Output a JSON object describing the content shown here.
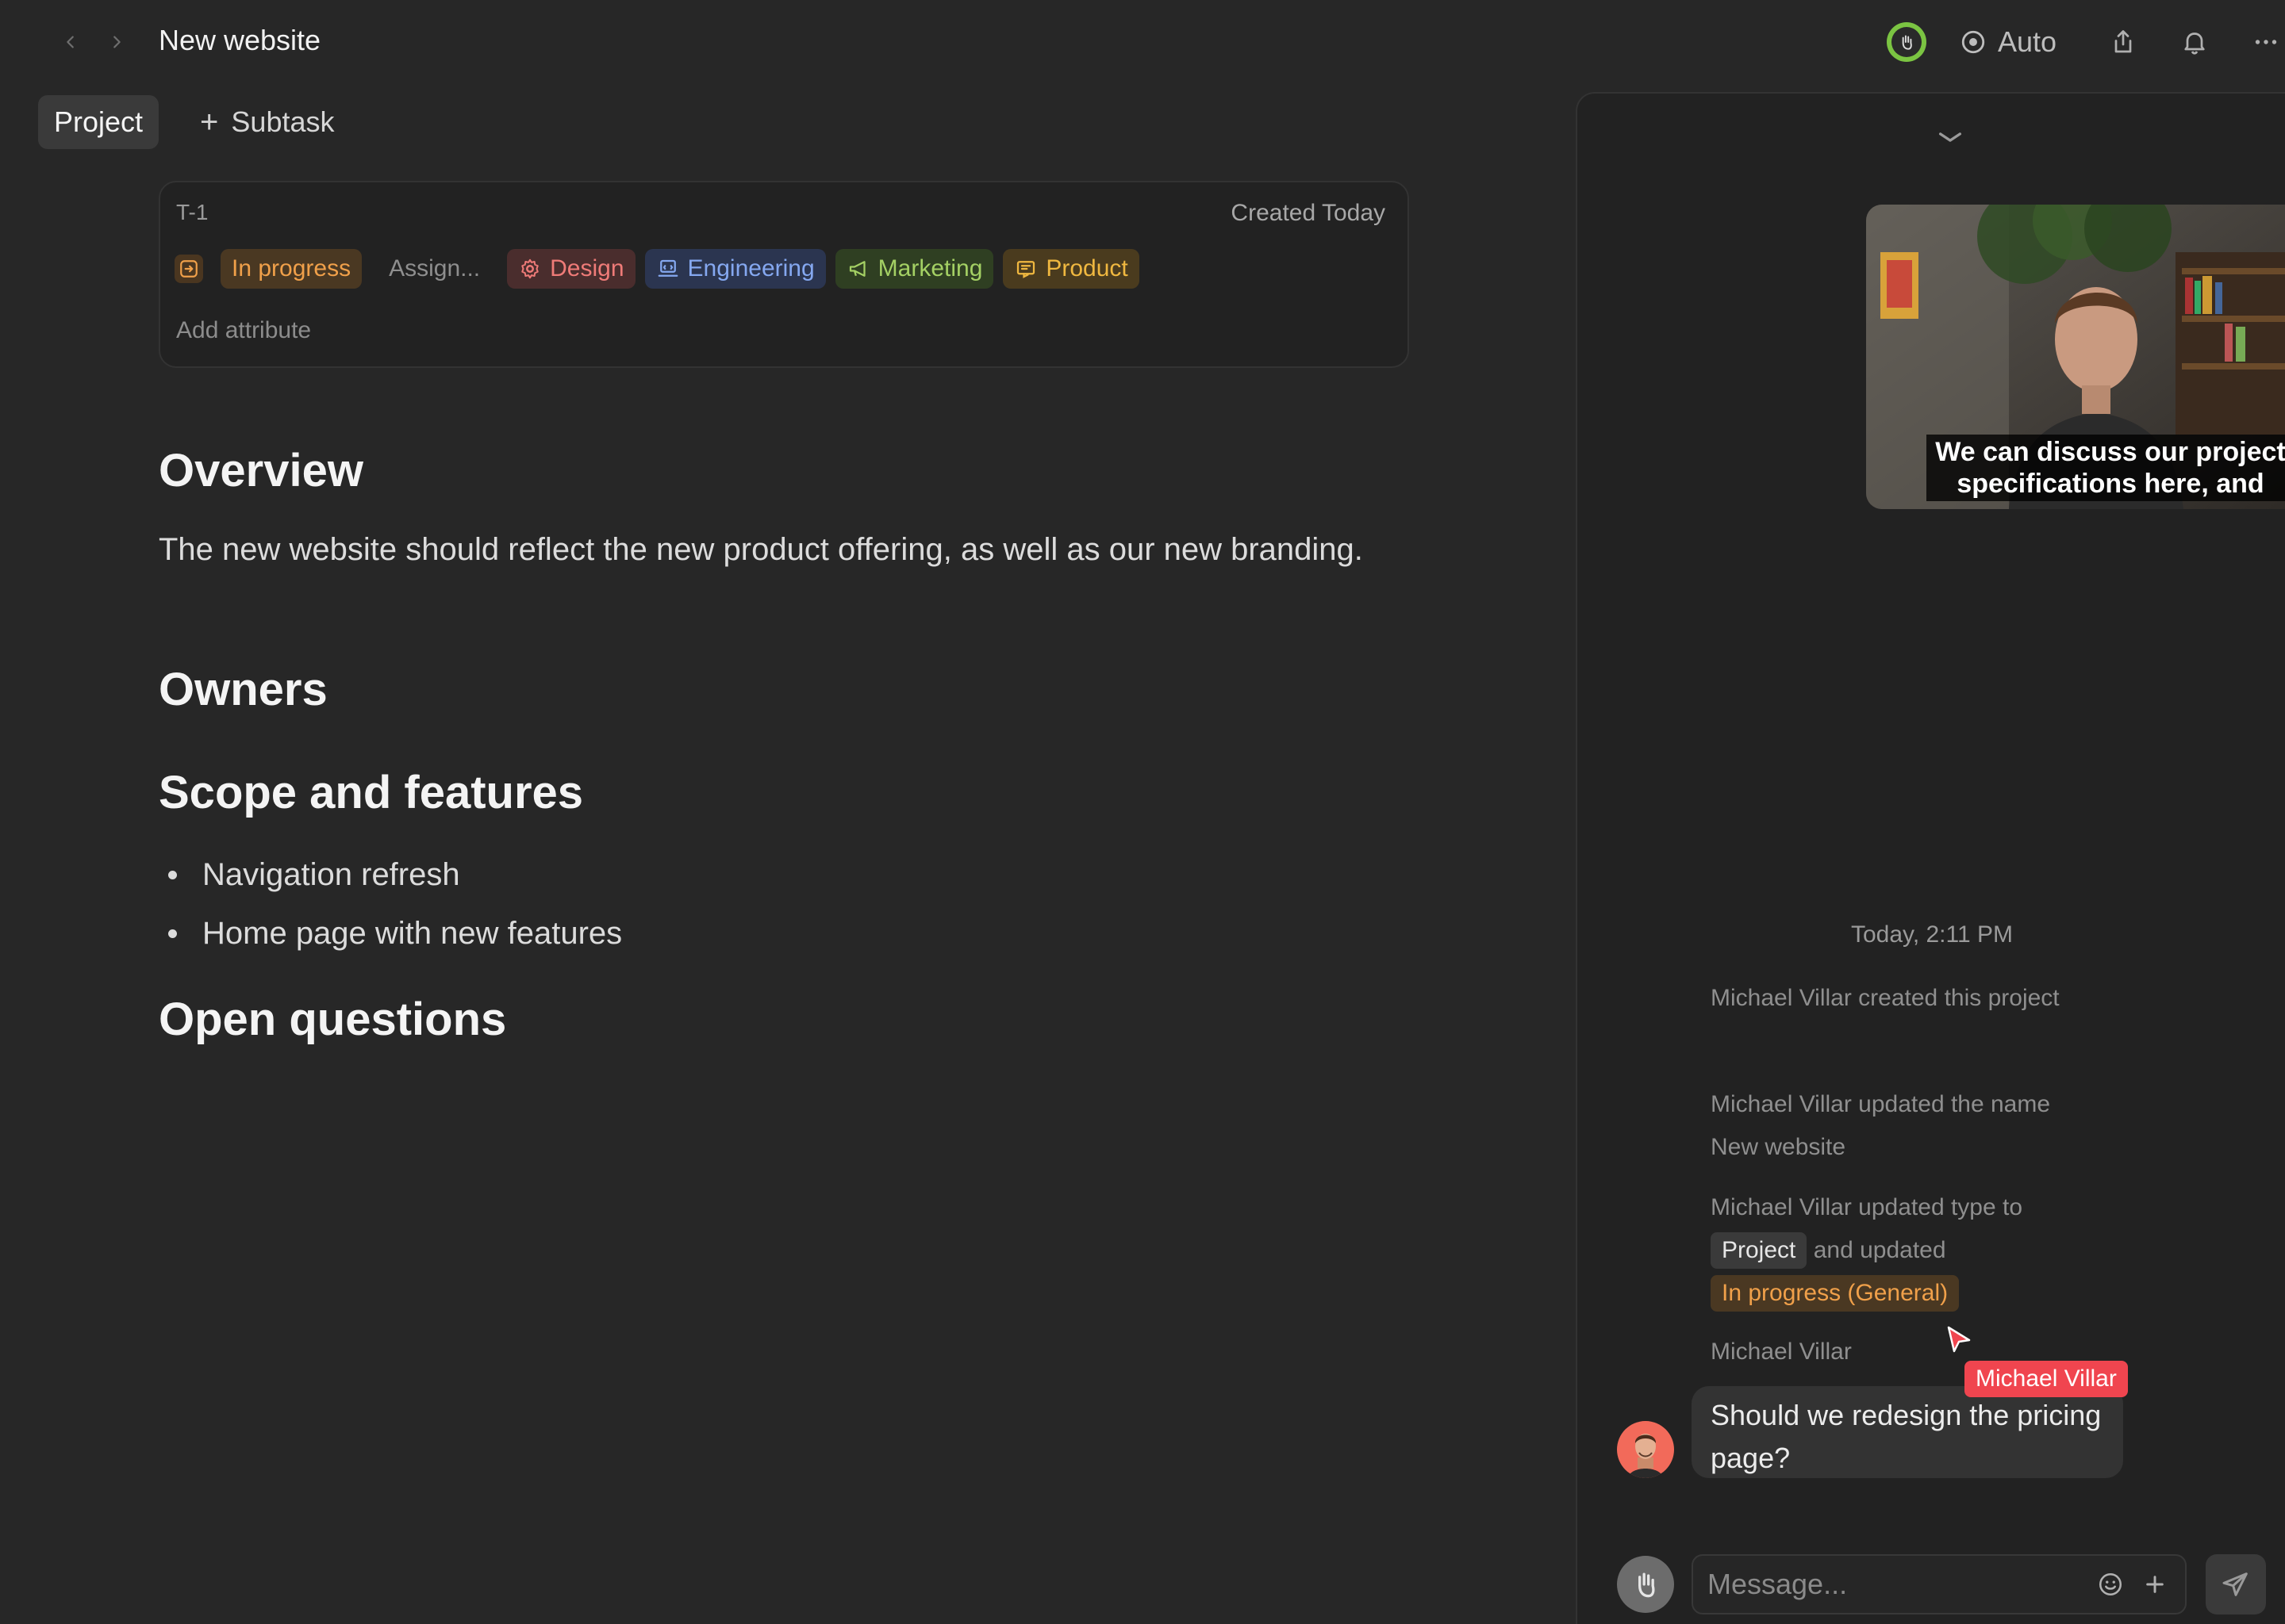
{
  "header": {
    "title": "New website",
    "auto_label": "Auto",
    "icons": [
      "chevron-left-icon",
      "chevron-right-icon",
      "target-icon",
      "share-icon",
      "bell-icon",
      "more-icon"
    ]
  },
  "tabs": [
    {
      "label": "Project",
      "active": true
    },
    {
      "label": "Subtask",
      "active": false
    }
  ],
  "attributes": {
    "id": "T-1",
    "created": "Created Today",
    "status": "In progress",
    "assignee": "Assign...",
    "tags": [
      {
        "label": "Design",
        "color": "#ef7b78"
      },
      {
        "label": "Engineering",
        "color": "#85a8f0"
      },
      {
        "label": "Marketing",
        "color": "#a4d064"
      },
      {
        "label": "Product",
        "color": "#f0b840"
      }
    ],
    "add_attribute": "Add attribute"
  },
  "document": {
    "overview_heading": "Overview",
    "overview_text": "The new website should reflect the new product offering, as well as our new branding.",
    "owners_heading": "Owners",
    "scope_heading": "Scope and features",
    "scope_items": [
      "Navigation refresh",
      "Home page with new features"
    ],
    "questions_heading": "Open questions"
  },
  "panel": {
    "video_caption": "We can discuss our project specifications here, and",
    "timestamp": "Today, 2:11 PM",
    "activity": {
      "created": "Michael Villar created this project",
      "renamed": "Michael Villar updated the name",
      "renamed_value": "New website",
      "type_update": "Michael Villar updated type to",
      "type_chip": "Project",
      "and_updated": "and updated",
      "status_chip": "In progress (General)"
    },
    "sender": "Michael Villar",
    "message": "Should we redesign the pricing page?",
    "cursor_label": "Michael Villar",
    "composer_placeholder": "Message..."
  },
  "colors": {
    "background": "#272727",
    "panel": "#222222",
    "status_orange": "#f0a04a",
    "cursor_red": "#f0454f",
    "presence_green": "#7bc442"
  }
}
